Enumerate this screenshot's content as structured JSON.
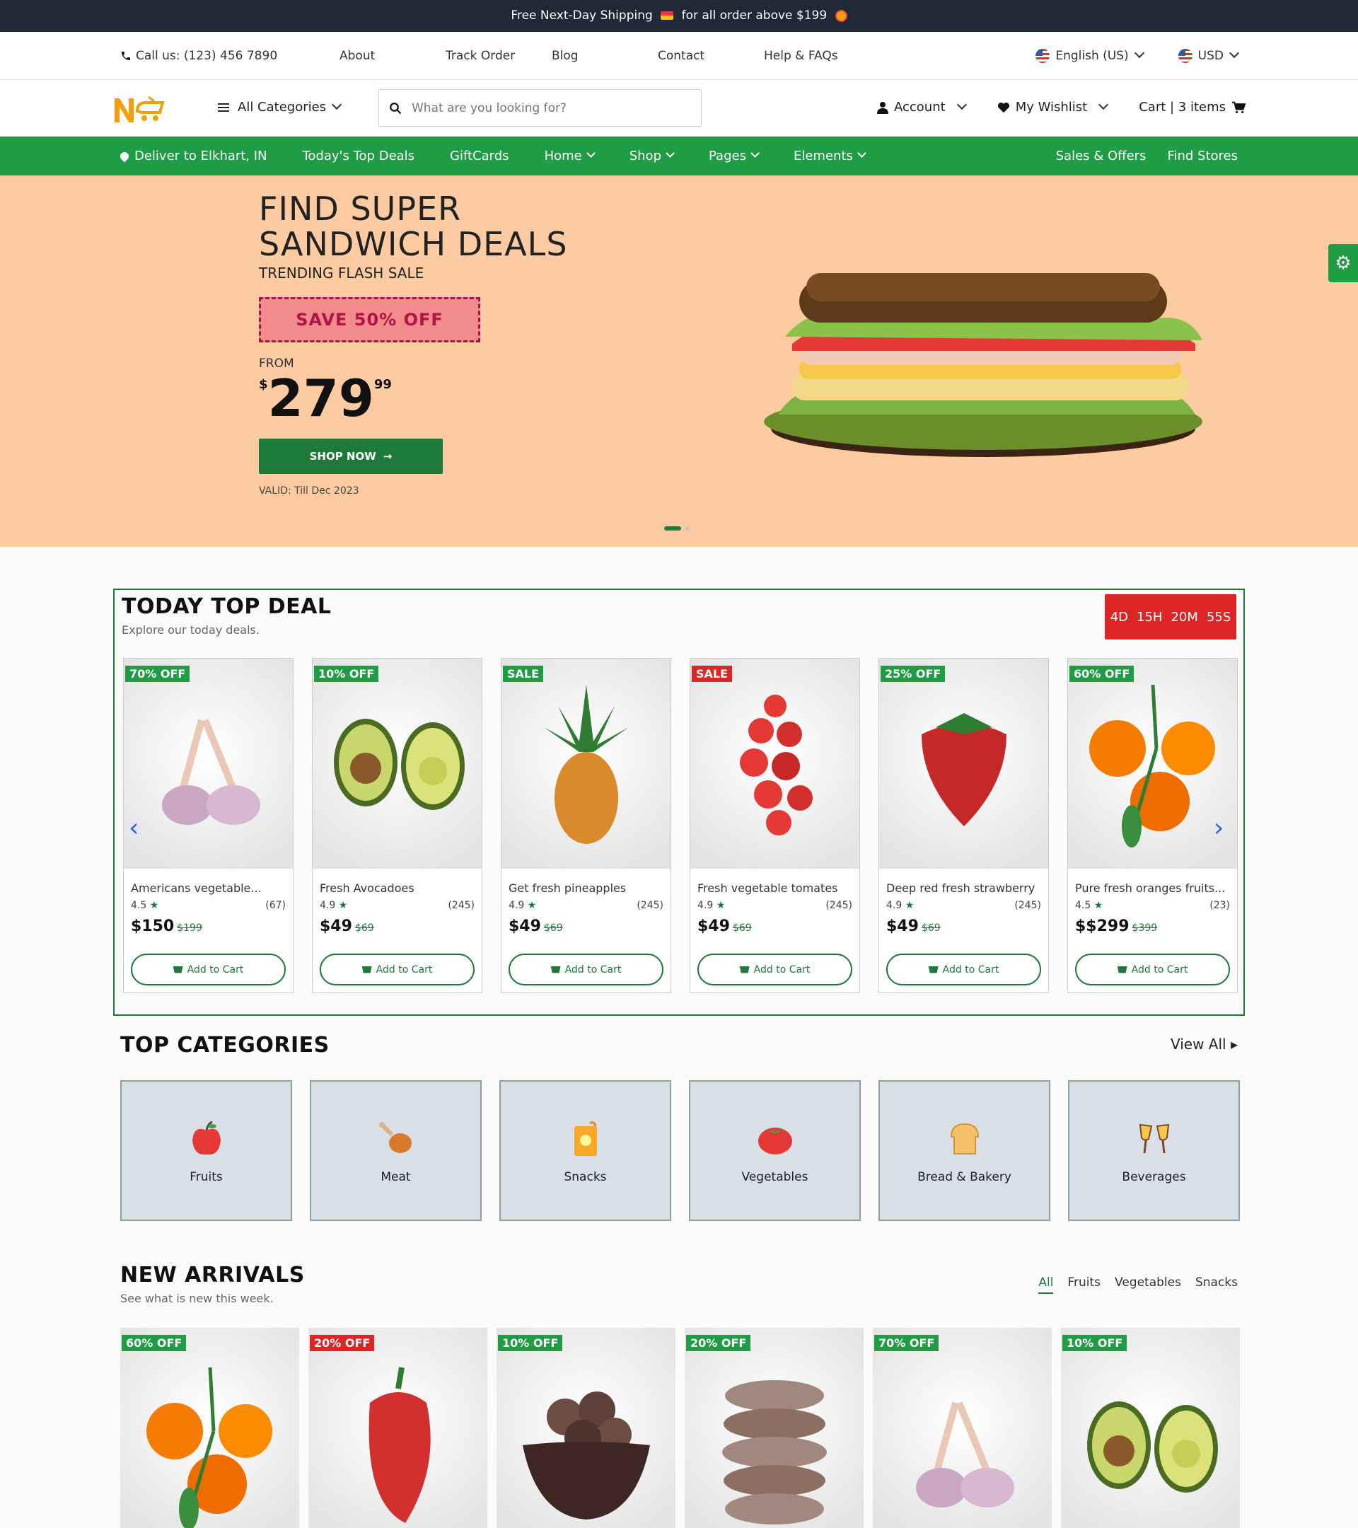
{
  "topbar": {
    "text_a": "Free Next-Day Shipping",
    "text_b": "for all order above $199"
  },
  "infobar": {
    "phone": "Call us: (123) 456 7890",
    "links": [
      "About",
      "Track Order",
      "Blog",
      "Contact",
      "Help & FAQs"
    ],
    "language": "English (US)",
    "currency": "USD"
  },
  "header": {
    "logo": "N",
    "all_categories": "All Categories",
    "search_placeholder": "What are you looking for?",
    "account": "Account",
    "wishlist": "My Wishlist",
    "cart": "Cart | 3 items"
  },
  "nav": {
    "deliver": "Deliver to Elkhart, IN",
    "items": [
      "Today's Top Deals",
      "GiftCards",
      "Home",
      "Shop",
      "Pages",
      "Elements"
    ],
    "right": [
      "Sales & Offers",
      "Find Stores"
    ]
  },
  "hero": {
    "title_1": "FIND SUPER",
    "title_2": "SANDWICH DEALS",
    "subtitle": "TRENDING FLASH SALE",
    "badge": "SAVE 50% OFF",
    "from": "FROM",
    "currency": "$",
    "price": "279",
    "cents": "99",
    "button": "SHOP NOW",
    "valid": "VALID: Till Dec 2023",
    "slide_count": 2,
    "active_slide": 1
  },
  "deals": {
    "title": "TODAY TOP DEAL",
    "subtitle": "Explore our today deals.",
    "timer": [
      "4D",
      "15H",
      "20M",
      "55S"
    ],
    "add_label": "Add to Cart",
    "products": [
      {
        "tag": "70% OFF",
        "tag_color": "green",
        "name": "Americans vegetable...",
        "rating": "4.5",
        "reviews": "(67)",
        "price": "$150",
        "old": "$199",
        "icon": "garlic"
      },
      {
        "tag": "10% OFF",
        "tag_color": "green",
        "name": "Fresh Avocadoes",
        "rating": "4.9",
        "reviews": "(245)",
        "price": "$49",
        "old": "$69",
        "icon": "avocado"
      },
      {
        "tag": "SALE",
        "tag_color": "green",
        "name": "Get fresh pineapples",
        "rating": "4.9",
        "reviews": "(245)",
        "price": "$49",
        "old": "$69",
        "icon": "pineapple"
      },
      {
        "tag": "SALE",
        "tag_color": "red",
        "name": "Fresh vegetable tomates",
        "rating": "4.9",
        "reviews": "(245)",
        "price": "$49",
        "old": "$69",
        "icon": "tomato"
      },
      {
        "tag": "25% OFF",
        "tag_color": "green",
        "name": "Deep red fresh strawberry",
        "rating": "4.9",
        "reviews": "(245)",
        "price": "$49",
        "old": "$69",
        "icon": "strawberry"
      },
      {
        "tag": "60% OFF",
        "tag_color": "green",
        "name": "Pure fresh oranges fruits...",
        "rating": "4.5",
        "reviews": "(23)",
        "price": "$$299",
        "old": "$399",
        "icon": "orange"
      }
    ]
  },
  "categories": {
    "title": "TOP CATEGORIES",
    "view_all": "View All",
    "items": [
      {
        "label": "Fruits",
        "icon": "apple"
      },
      {
        "label": "Meat",
        "icon": "drumstick"
      },
      {
        "label": "Snacks",
        "icon": "snack-bag"
      },
      {
        "label": "Vegetables",
        "icon": "tomato"
      },
      {
        "label": "Bread & Bakery",
        "icon": "bread"
      },
      {
        "label": "Beverages",
        "icon": "glasses"
      }
    ]
  },
  "new_arrivals": {
    "title": "NEW ARRIVALS",
    "subtitle": "See what is new this week.",
    "tabs": [
      "All",
      "Fruits",
      "Vegetables",
      "Snacks"
    ],
    "active_tab": "All",
    "products": [
      {
        "tag": "60% OFF",
        "tag_color": "green",
        "icon": "orange"
      },
      {
        "tag": "20% OFF",
        "tag_color": "red",
        "icon": "pepper"
      },
      {
        "tag": "10% OFF",
        "tag_color": "green",
        "icon": "cookies-bowl"
      },
      {
        "tag": "20% OFF",
        "tag_color": "green",
        "icon": "cookies-stack"
      },
      {
        "tag": "70% OFF",
        "tag_color": "green",
        "icon": "garlic"
      },
      {
        "tag": "10% OFF",
        "tag_color": "green",
        "icon": "avocado"
      }
    ]
  },
  "colors": {
    "primary_green": "#1f9d45",
    "dark_green": "#1d7a3a",
    "red": "#dc2626",
    "hero_bg": "#fdcba1",
    "topbar_bg": "#1f2937"
  }
}
